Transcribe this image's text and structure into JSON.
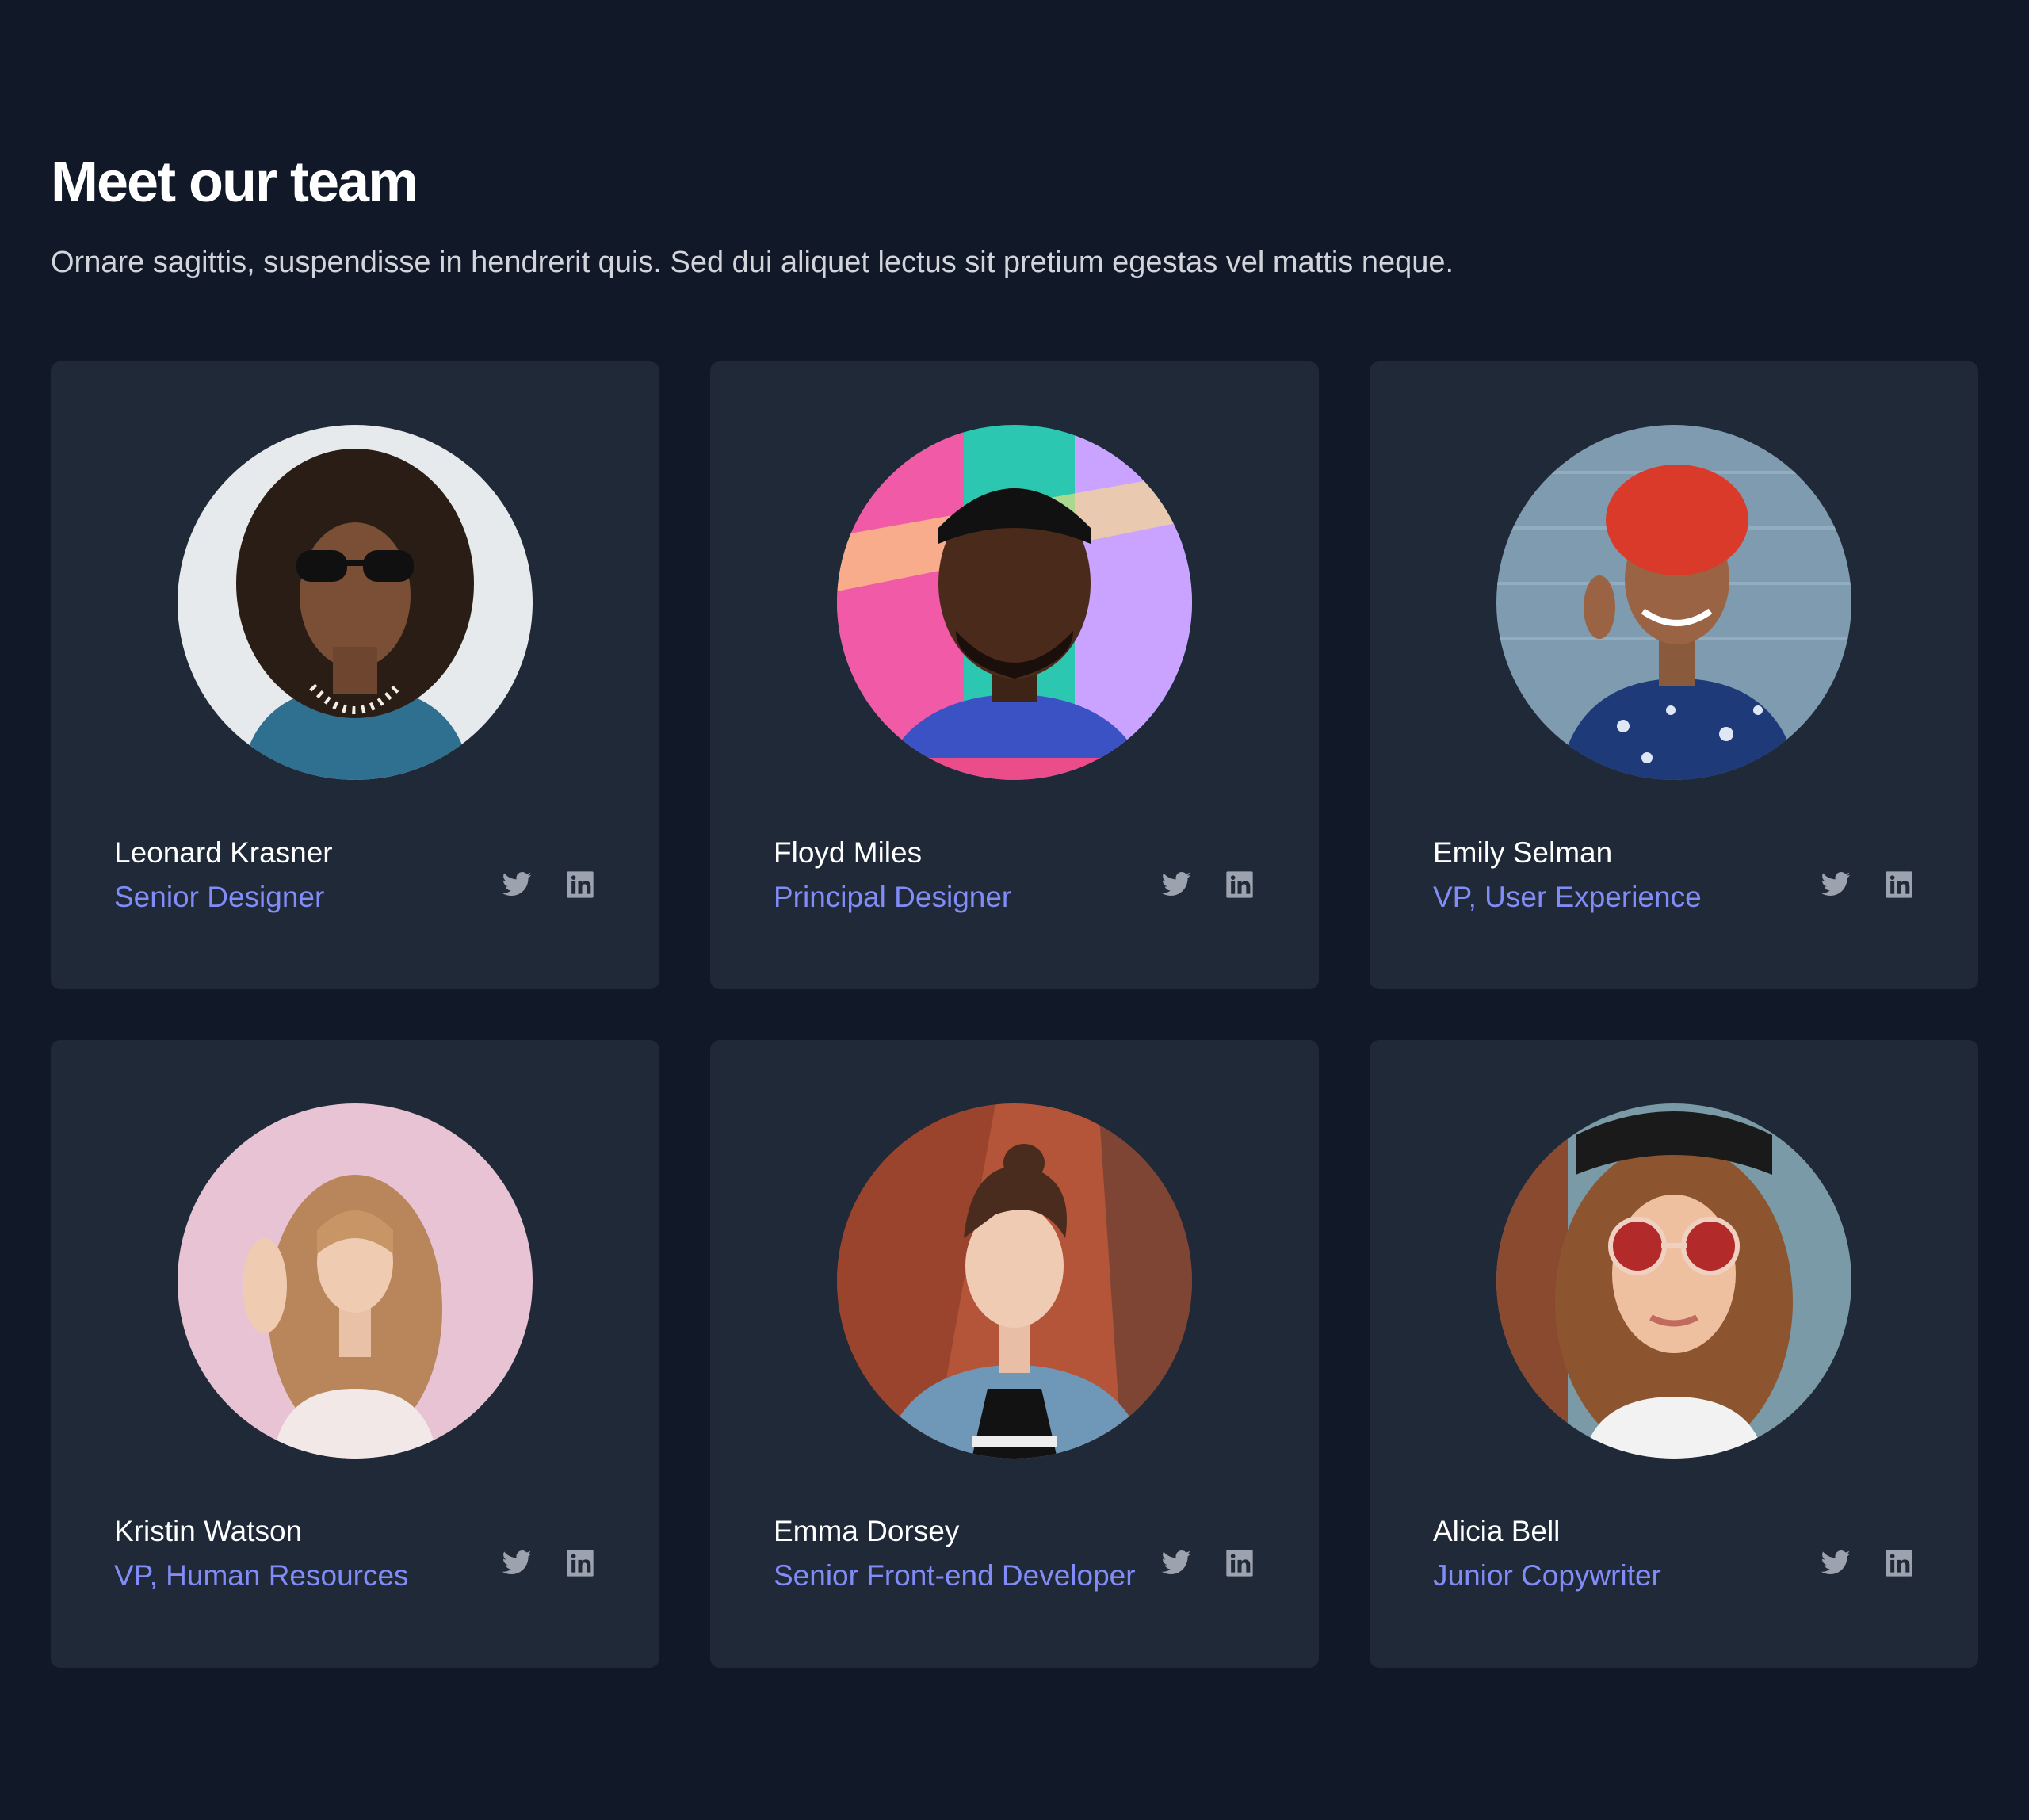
{
  "header": {
    "title": "Meet our team",
    "subtitle": "Ornare sagittis, suspendisse in hendrerit quis. Sed dui aliquet lectus sit pretium egestas vel mattis neque."
  },
  "team": [
    {
      "name": "Leonard Krasner",
      "role": "Senior Designer",
      "twitter_icon": "twitter-icon",
      "linkedin_icon": "linkedin-icon"
    },
    {
      "name": "Floyd Miles",
      "role": "Principal Designer",
      "twitter_icon": "twitter-icon",
      "linkedin_icon": "linkedin-icon"
    },
    {
      "name": "Emily Selman",
      "role": "VP, User Experience",
      "twitter_icon": "twitter-icon",
      "linkedin_icon": "linkedin-icon"
    },
    {
      "name": "Kristin Watson",
      "role": "VP, Human Resources",
      "twitter_icon": "twitter-icon",
      "linkedin_icon": "linkedin-icon"
    },
    {
      "name": "Emma Dorsey",
      "role": "Senior Front-end Developer",
      "twitter_icon": "twitter-icon",
      "linkedin_icon": "linkedin-icon"
    },
    {
      "name": "Alicia Bell",
      "role": "Junior Copywriter",
      "twitter_icon": "twitter-icon",
      "linkedin_icon": "linkedin-icon"
    }
  ],
  "colors": {
    "background": "#111827",
    "card": "#1f2937",
    "accent": "#818cf8",
    "icon": "#9ca3af"
  }
}
